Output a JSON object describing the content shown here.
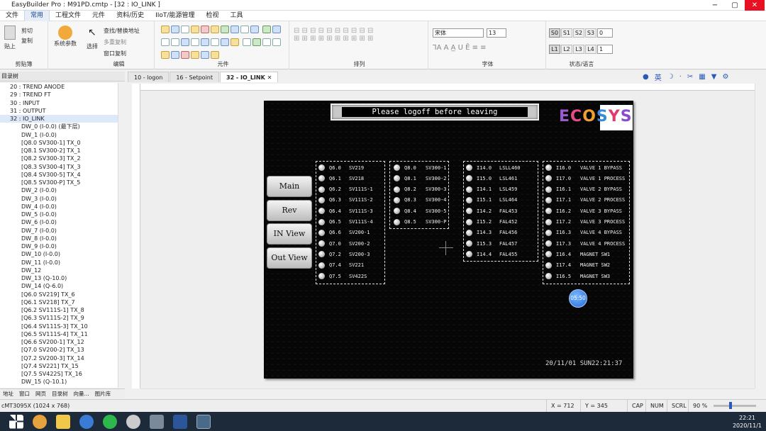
{
  "window": {
    "title": "EasyBuilder Pro : M91PD.cmtp - [32 : IO_LINK ]"
  },
  "menu": [
    "文件",
    "常用",
    "工程文件",
    "元件",
    "资料/历史",
    "IIoT/能源管理",
    "检视",
    "工具"
  ],
  "ribbon": {
    "groups": [
      "剪贴簿",
      "编辑",
      "元件",
      "排列",
      "字体",
      "状态/语言"
    ],
    "paste": "贴上",
    "cut": "剪切",
    "copy": "复制",
    "system_params": "系统参数",
    "select": "选择",
    "find_replace": "查找/替换地址",
    "multi_copy": "多重复制",
    "window_copy": "窗口复制",
    "font_name": "宋体",
    "font_size": "13",
    "state_buttons": [
      "S0",
      "S1",
      "S2",
      "S3"
    ],
    "state_value": "0",
    "lang_buttons": [
      "L1",
      "L2",
      "L3",
      "L4"
    ],
    "lang_value": "1"
  },
  "left_panel": {
    "title": "目录树",
    "tree": [
      "20 : TREND ANODE",
      "29 : TREND FT",
      "30 : INPUT",
      "31 : OUTPUT",
      "32 : IO_LINK",
      "DW_0 (I-0.0) (最下层)",
      "DW_1 (I-0.0)",
      "[Q8.0 SV300-1] TX_0",
      "[Q8.1 SV300-2] TX_1",
      "[Q8.2 SV300-3] TX_2",
      "[Q8.3 SV300-4] TX_3",
      "[Q8.4 SV300-5] TX_4",
      "[Q8.5 SV300-P] TX_5",
      "DW_2 (I-0.0)",
      "DW_3 (I-0.0)",
      "DW_4 (I-0.0)",
      "DW_5 (I-0.0)",
      "DW_6 (I-0.0)",
      "DW_7 (I-0.0)",
      "DW_8 (I-0.0)",
      "DW_9 (I-0.0)",
      "DW_10 (I-0.0)",
      "DW_11 (I-0.0)",
      "DW_12",
      "DW_13 (Q-10.0)",
      "DW_14 (Q-6.0)",
      "[Q6.0 SV219] TX_6",
      "[Q6.1 SV218] TX_7",
      "[Q6.2 SV111S-1] TX_8",
      "[Q6.3 SV111S-2] TX_9",
      "[Q6.4 SV111S-3] TX_10",
      "[Q6.5 SV111S-4] TX_11",
      "[Q6.6 SV200-1] TX_12",
      "[Q7.0 SV200-2] TX_13",
      "[Q7.2 SV200-3] TX_14",
      "[Q7.4 SV221] TX_15",
      "[Q7.5 SV422S] TX_16",
      "DW_15 (Q-10.1)"
    ],
    "tabs": [
      "地址",
      "窗口",
      "网页",
      "目录树",
      "向量...",
      "图片库"
    ]
  },
  "tabs": [
    "10 - logon",
    "16 - Setpoint",
    "32 - IO_LINK"
  ],
  "hmi": {
    "banner": "Please logoff before leaving",
    "logo": "ECOSYS",
    "nav": [
      "Main",
      "Rev",
      "IN View",
      "Out View"
    ],
    "panel1": [
      [
        "Q6.0",
        "SV219"
      ],
      [
        "Q6.1",
        "SV218"
      ],
      [
        "Q6.2",
        "SV111S-1"
      ],
      [
        "Q6.3",
        "SV111S-2"
      ],
      [
        "Q6.4",
        "SV111S-3"
      ],
      [
        "Q6.5",
        "SV111S-4"
      ],
      [
        "Q6.6",
        "SV200-1"
      ],
      [
        "Q7.0",
        "SV200-2"
      ],
      [
        "Q7.2",
        "SV200-3"
      ],
      [
        "Q7.4",
        "SV221"
      ],
      [
        "Q7.5",
        "SV422S"
      ]
    ],
    "panel2": [
      [
        "Q8.0",
        "SV300-1"
      ],
      [
        "Q8.1",
        "SV300-2"
      ],
      [
        "Q8.2",
        "SV300-3"
      ],
      [
        "Q8.3",
        "SV300-4"
      ],
      [
        "Q8.4",
        "SV300-5"
      ],
      [
        "Q8.5",
        "SV300-P"
      ]
    ],
    "panel3": [
      [
        "I14.0",
        "LSLL460"
      ],
      [
        "I15.0",
        "LSL461"
      ],
      [
        "I14.1",
        "LSL459"
      ],
      [
        "I15.1",
        "LSL464"
      ],
      [
        "I14.2",
        "FAL453"
      ],
      [
        "I15.2",
        "FAL452"
      ],
      [
        "I14.3",
        "FAL456"
      ],
      [
        "I15.3",
        "FAL457"
      ],
      [
        "I14.4",
        "FAL455"
      ]
    ],
    "panel4": [
      [
        "I16.0",
        "VALVE 1 BYPASS"
      ],
      [
        "I17.0",
        "VALVE 1 PROCESS"
      ],
      [
        "I16.1",
        "VALVE 2 BYPASS"
      ],
      [
        "I17.1",
        "VALVE 2 PROCESS"
      ],
      [
        "I16.2",
        "VALVE 3 BYPASS"
      ],
      [
        "I17.2",
        "VALVE 3 PROCESS"
      ],
      [
        "I16.3",
        "VALVE 4 BYPASS"
      ],
      [
        "I17.3",
        "VALVE 4 PROCESS"
      ],
      [
        "I16.4",
        "MAGNET SW1"
      ],
      [
        "I17.4",
        "MAGNET SW2"
      ],
      [
        "I16.5",
        "MAGNET SW3"
      ]
    ],
    "clock": "20/11/01 SUN22:21:37",
    "round_button": "05:50"
  },
  "status": {
    "model": "cMT3095X (1024 x 768)",
    "x": "X = 712",
    "y": "Y = 345",
    "cap": "CAP",
    "num": "NUM",
    "scrl": "SCRL",
    "zoom": "90 %"
  },
  "taskbar": {
    "time": "22:21",
    "date": "2020/11/1"
  }
}
